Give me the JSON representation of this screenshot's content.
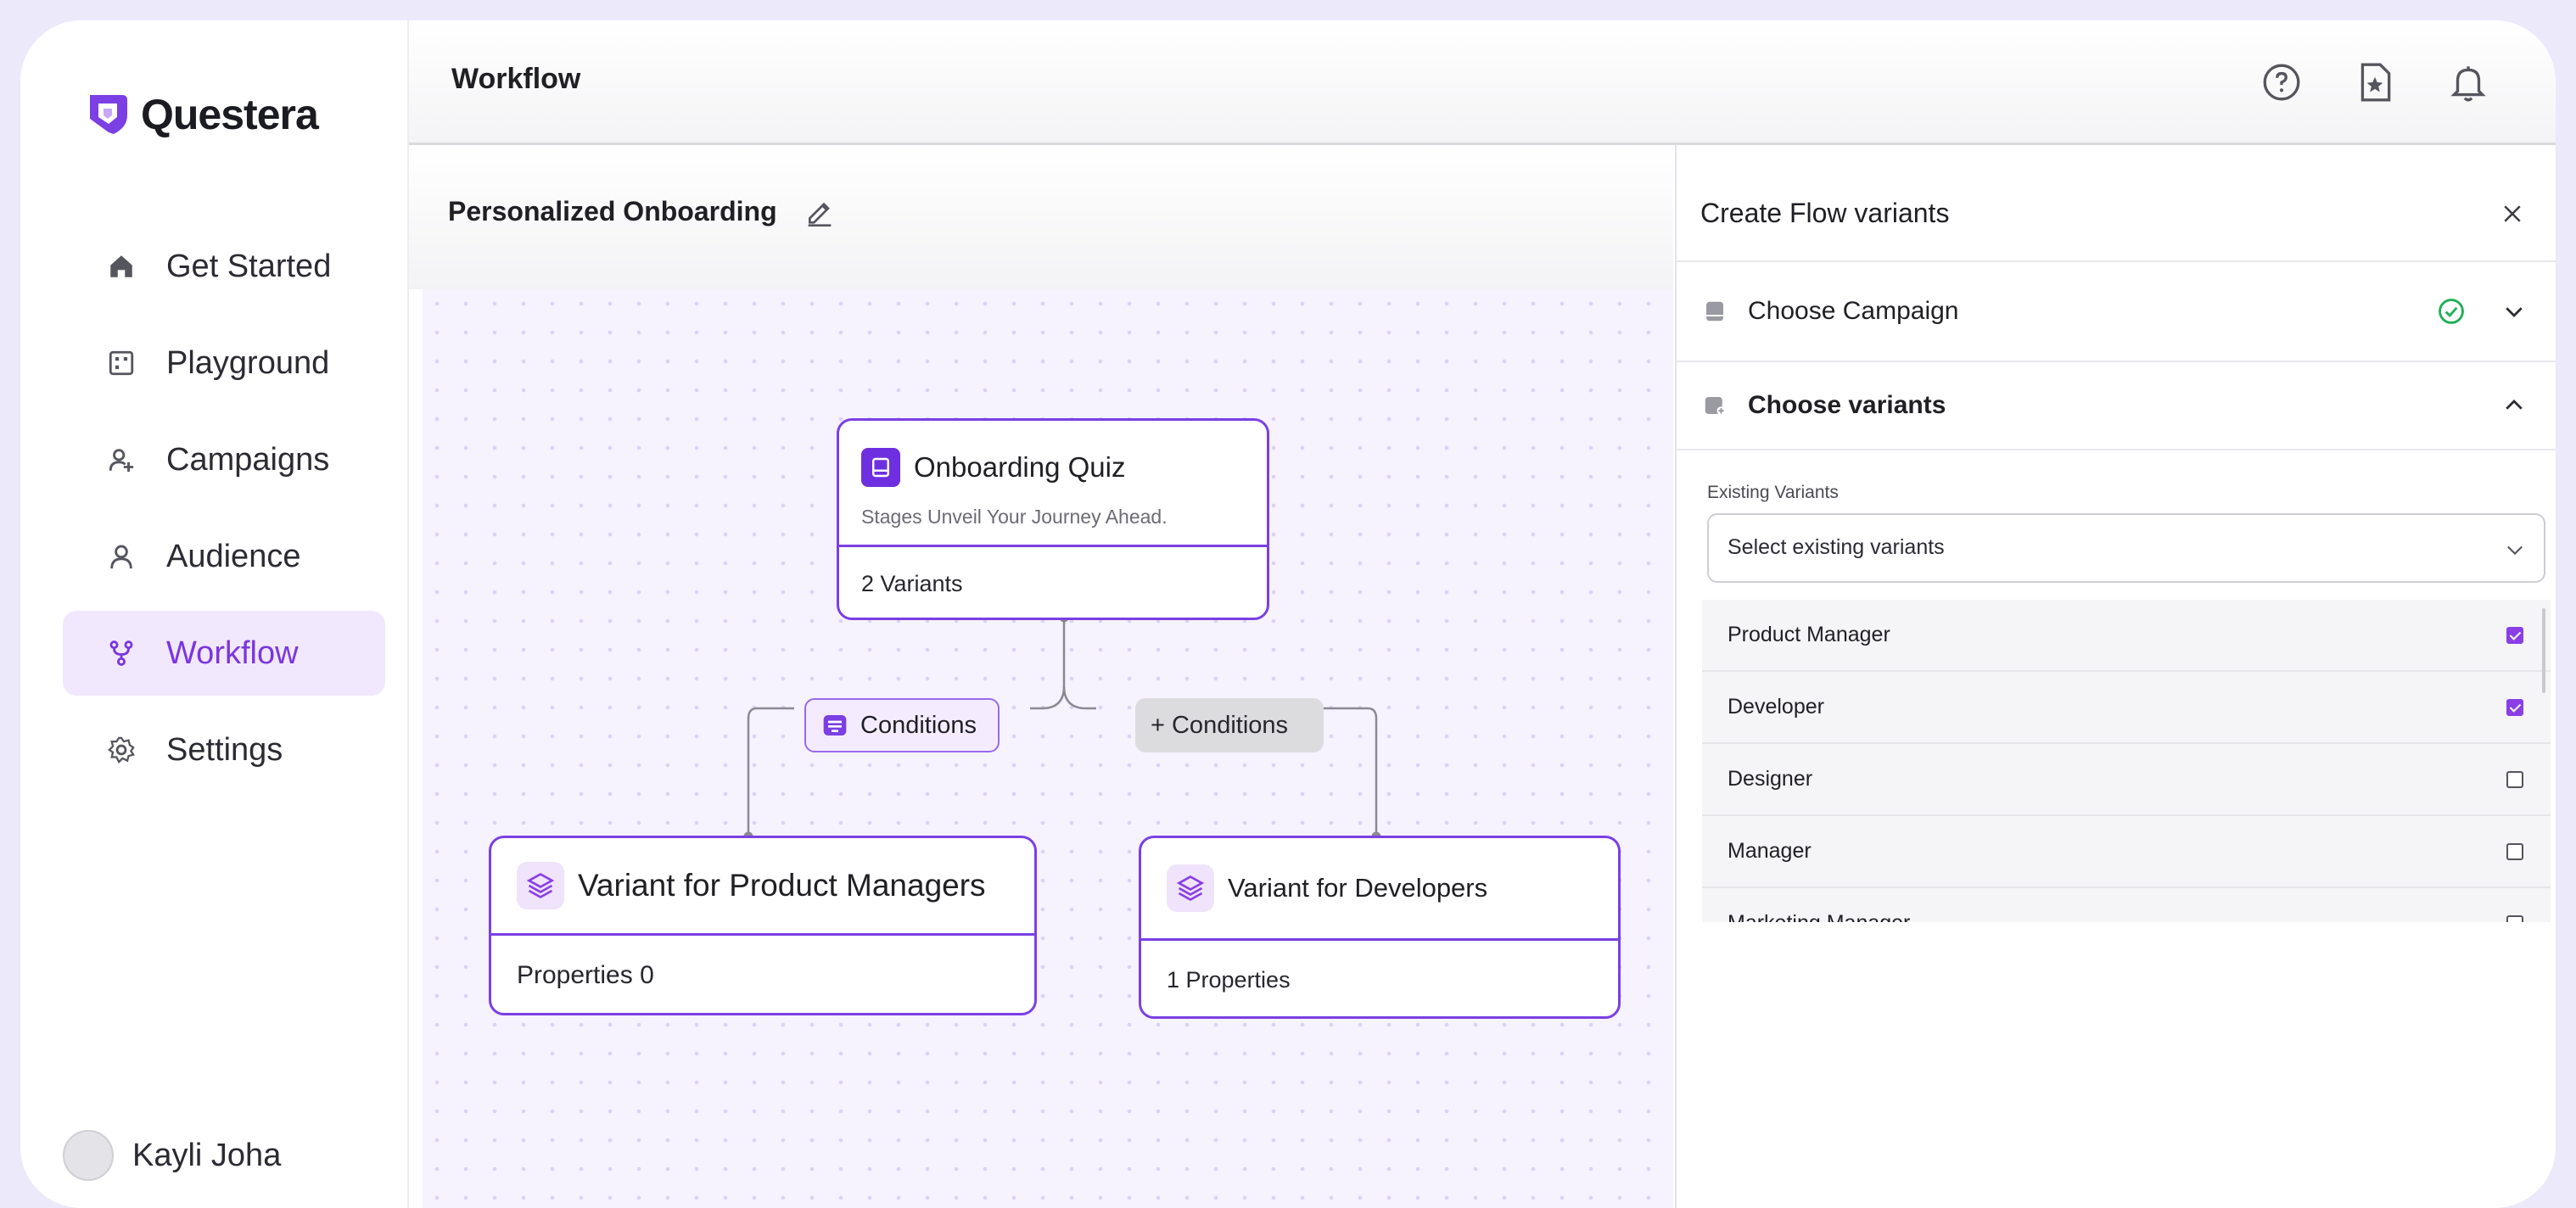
{
  "app": {
    "name": "Questera",
    "brand_color": "#7b3fe4"
  },
  "sidebar": {
    "items": [
      {
        "label": "Get Started",
        "icon": "home-icon"
      },
      {
        "label": "Playground",
        "icon": "grid-icon"
      },
      {
        "label": "Campaigns",
        "icon": "user-plus-icon"
      },
      {
        "label": "Audience",
        "icon": "user-icon"
      },
      {
        "label": "Workflow",
        "icon": "workflow-icon",
        "active": true
      },
      {
        "label": "Settings",
        "icon": "gear-icon"
      }
    ],
    "user": {
      "name": "Kayli Joha"
    }
  },
  "header": {
    "title": "Workflow",
    "icons": [
      "help-icon",
      "document-star-icon",
      "bell-icon"
    ]
  },
  "canvas": {
    "flow_title": "Personalized Onboarding",
    "root_node": {
      "title": "Onboarding Quiz",
      "subtitle": "Stages Unveil Your Journey Ahead.",
      "footer": "2 Variants"
    },
    "conditions_left": "Conditions",
    "conditions_right": "+ Conditions",
    "variant_left": {
      "title": "Variant for Product Managers",
      "footer": "Properties 0"
    },
    "variant_right": {
      "title": "Variant for Developers",
      "footer": "1 Properties"
    }
  },
  "panel": {
    "title": "Create Flow variants",
    "sections": {
      "campaign": {
        "label": "Choose Campaign",
        "status": "completed"
      },
      "variants": {
        "label": "Choose variants",
        "expanded": true
      }
    },
    "existing_variants": {
      "label": "Existing Variants",
      "placeholder": "Select existing variants",
      "options": [
        {
          "label": "Product Manager",
          "checked": true
        },
        {
          "label": "Developer",
          "checked": true
        },
        {
          "label": "Designer",
          "checked": false
        },
        {
          "label": "Manager",
          "checked": false
        },
        {
          "label": "Marketing Manager",
          "checked": false
        }
      ]
    }
  }
}
